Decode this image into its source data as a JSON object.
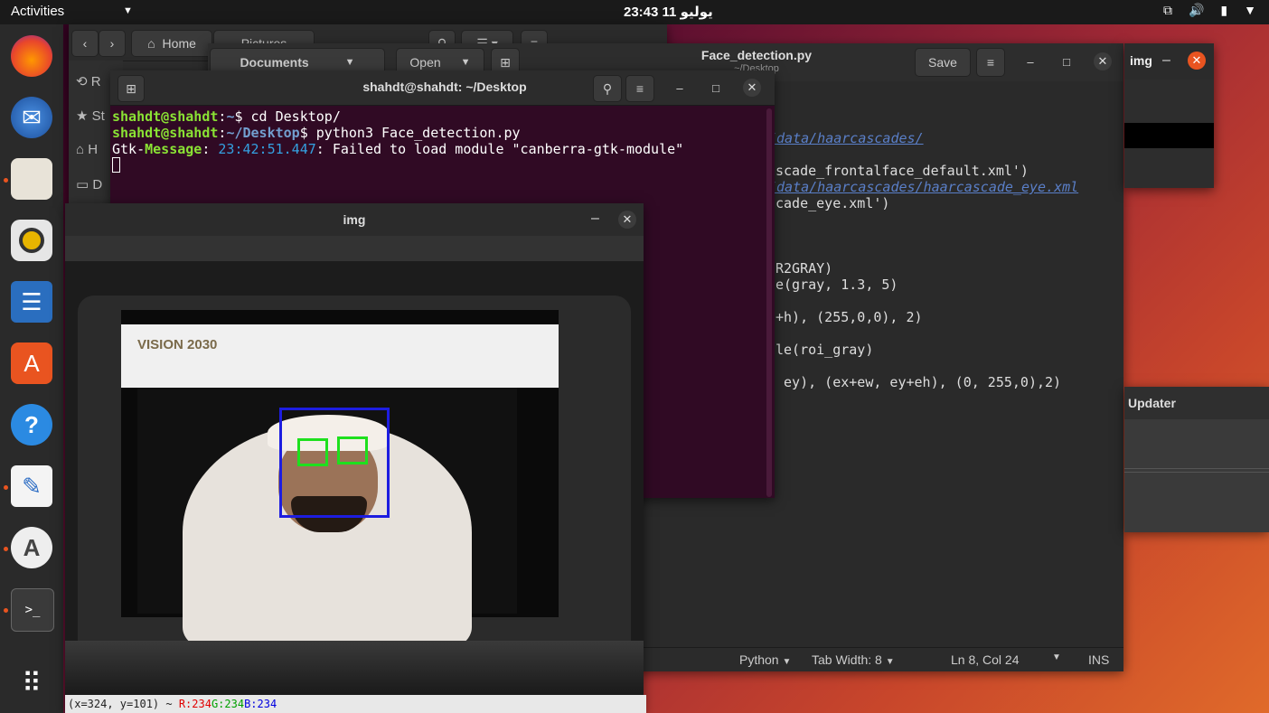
{
  "topbar": {
    "activities": "Activities",
    "clock": "يوليو 11  23:43"
  },
  "dock": {
    "items": [
      {
        "name": "firefox-icon",
        "label": "Firefox"
      },
      {
        "name": "thunderbird-icon",
        "label": "Thunderbird"
      },
      {
        "name": "files-icon",
        "label": "Files"
      },
      {
        "name": "rhythmbox-icon",
        "label": "Rhythmbox"
      },
      {
        "name": "libreoffice-writer-icon",
        "label": "Writer"
      },
      {
        "name": "software-icon",
        "label": "Software"
      },
      {
        "name": "help-icon",
        "label": "Help"
      },
      {
        "name": "text-editor-icon",
        "label": "Text Editor"
      },
      {
        "name": "software-updater-icon",
        "label": "Updater"
      },
      {
        "name": "terminal-icon",
        "label": "Terminal"
      },
      {
        "name": "show-apps-icon",
        "label": "Show Applications"
      }
    ]
  },
  "files": {
    "home_label": "Home",
    "pictures_label": "Pictures",
    "sidebar": [
      "R",
      "St",
      "H",
      "D"
    ]
  },
  "gedit": {
    "documents_label": "Documents",
    "open_label": "Open",
    "title": "Face_detection.py",
    "subtitle": "~/Desktop",
    "save_label": "Save",
    "code": [
      {
        "text": "/data/haarcascades/",
        "cls": "comment"
      },
      {
        "text": "scade_frontalface_default.xml')",
        "cls": ""
      },
      {
        "text": "/data/haarcascades/haarcascade_eye.xml",
        "cls": "comment"
      },
      {
        "text": "cade_eye.xml')",
        "cls": ""
      },
      {
        "text": "R2GRAY)",
        "cls": ""
      },
      {
        "text": "e(gray, 1.3, 5)",
        "cls": ""
      },
      {
        "text": "+h), (255,0,0), 2)",
        "cls": ""
      },
      {
        "text": "le(roi_gray)",
        "cls": ""
      },
      {
        "text": " ey), (ex+ew, ey+eh), (0, 255,0),2)",
        "cls": ""
      }
    ],
    "status": {
      "language": "Python",
      "tab_width": "Tab Width: 8",
      "position": "Ln 8, Col 24",
      "mode": "INS"
    }
  },
  "imgsmall": {
    "title": "img"
  },
  "updater": {
    "title": "Updater"
  },
  "terminal": {
    "title": "shahdt@shahdt: ~/Desktop",
    "lines": [
      {
        "user": "shahdt@shahdt",
        "path": "~",
        "cmd": "$ cd Desktop/"
      },
      {
        "user": "shahdt@shahdt",
        "path": "~/Desktop",
        "cmd": "$ python3 Face_detection.py"
      }
    ],
    "msg_prefix": "Gtk-",
    "msg_word": "Message",
    "msg_colon": ": ",
    "msg_time": "23:42:51.447",
    "msg_text": ": Failed to load module \"canberra-gtk-module\""
  },
  "imgwin": {
    "title": "img",
    "coords_prefix": "(x=324, y=101) ~ ",
    "r": "R:234",
    "g": "G:234",
    "b": "B:234",
    "screen_text": "VISION 2030"
  }
}
